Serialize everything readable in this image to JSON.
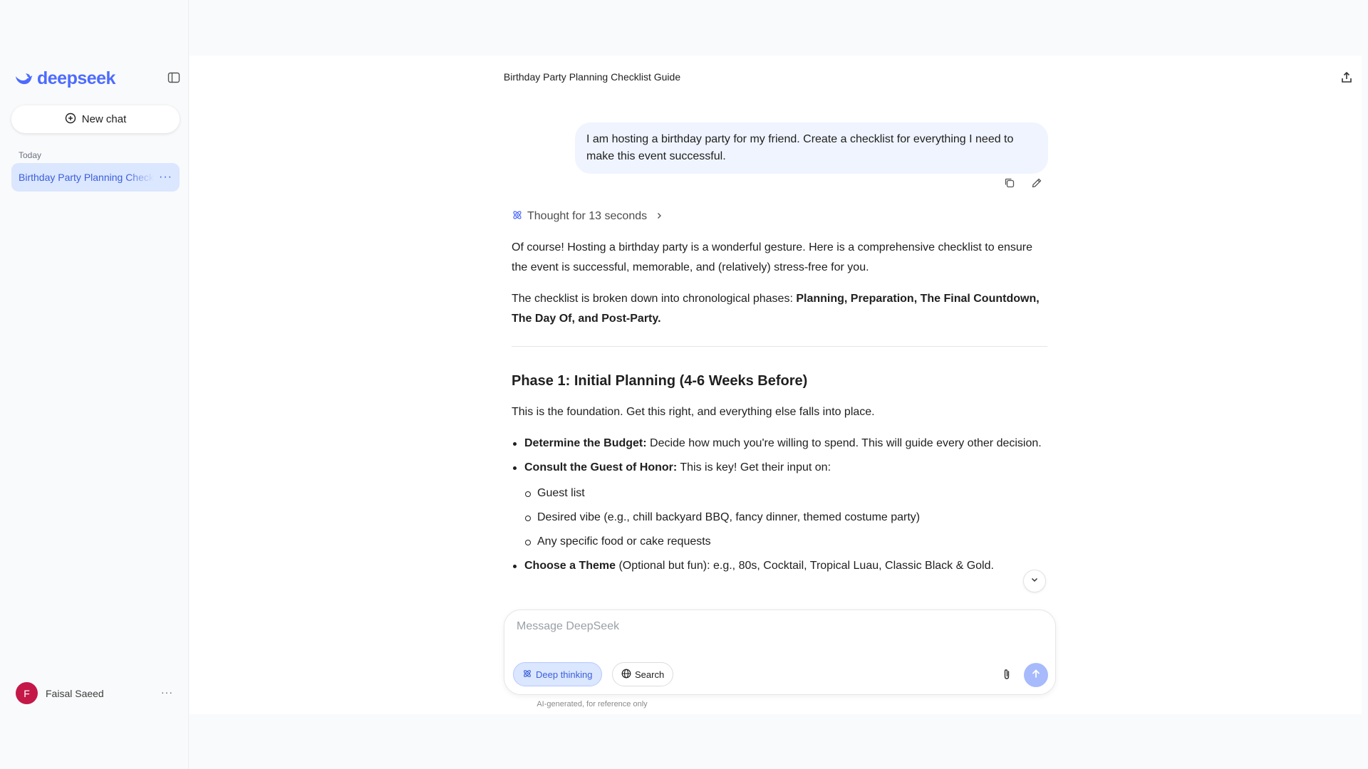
{
  "colors": {
    "brand": "#4d6bfe",
    "active_chat_bg": "#dbe6ff",
    "user_bubble_bg": "#eff4ff",
    "avatar_bg": "#c41848",
    "send_button_bg": "#a6bafc"
  },
  "sidebar": {
    "brand_name": "deepseek",
    "logo_icon": "whale-logo-icon",
    "toggle_icon": "sidebar-toggle-icon",
    "new_chat_label": "New chat",
    "section_today": "Today",
    "chats": [
      {
        "label": "Birthday Party Planning Checklist Guide",
        "active": true
      }
    ],
    "user": {
      "initial": "F",
      "name": "Faisal Saeed"
    }
  },
  "header": {
    "title": "Birthday Party Planning Checklist Guide",
    "share_icon": "share-icon"
  },
  "conversation": {
    "user_message": "I am hosting a birthday party for my friend. Create a checklist for everything I need to make this event successful.",
    "thought_label": "Thought for 13 seconds",
    "intro": "Of course! Hosting a birthday party is a wonderful gesture. Here is a comprehensive checklist to ensure the event is successful, memorable, and (relatively) stress-free for you.",
    "phases_lead": "The checklist is broken down into chronological phases: ",
    "phases_bold": "Planning, Preparation, The Final Countdown, The Day Of, and Post-Party.",
    "phase1_heading": "Phase 1: Initial Planning (4-6 Weeks Before)",
    "phase1_intro": "This is the foundation. Get this right, and everything else falls into place.",
    "budget_bold": "Determine the Budget:",
    "budget_text": " Decide how much you're willing to spend. This will guide every other decision.",
    "consult_bold": "Consult the Guest of Honor:",
    "consult_text": " This is key! Get their input on:",
    "consult_sub": [
      "Guest list",
      "Desired vibe (e.g., chill backyard BBQ, fancy dinner, themed costume party)",
      "Any specific food or cake requests"
    ],
    "theme_bold": "Choose a Theme",
    "theme_text": " (Optional but fun): e.g., 80s, Cocktail, Tropical Luau, Classic Black & Gold."
  },
  "composer": {
    "placeholder": "Message DeepSeek",
    "deep_thinking_label": "Deep thinking",
    "search_label": "Search",
    "disclaimer": "AI-generated, for reference only"
  }
}
